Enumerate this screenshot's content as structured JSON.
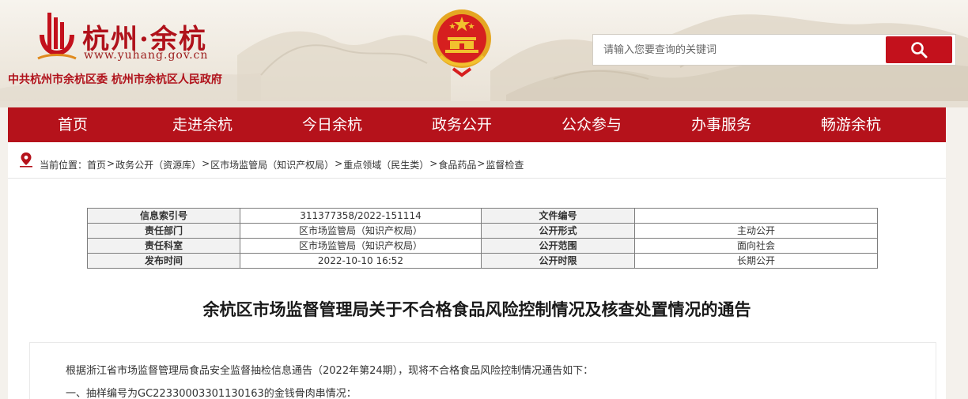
{
  "header": {
    "logo_title": "杭州·余杭",
    "logo_url": "www.yuhang.gov.cn",
    "site_owner": "中共杭州市余杭区委  杭州市余杭区人民政府",
    "search": {
      "placeholder": "请输入您要查询的关键词"
    }
  },
  "nav": {
    "items": [
      {
        "label": "首页"
      },
      {
        "label": "走进余杭"
      },
      {
        "label": "今日余杭"
      },
      {
        "label": "政务公开"
      },
      {
        "label": "公众参与"
      },
      {
        "label": "办事服务"
      },
      {
        "label": "畅游余杭"
      }
    ]
  },
  "breadcrumb": {
    "label": "当前位置：",
    "items": [
      {
        "label": "首页"
      },
      {
        "label": "政务公开（资源库）"
      },
      {
        "label": "区市场监管局（知识产权局）"
      },
      {
        "label": "重点领域（民生类）"
      },
      {
        "label": "食品药品"
      },
      {
        "label": "监督检查"
      }
    ],
    "separator": ">"
  },
  "meta": {
    "rows": [
      [
        "信息索引号",
        "311377358/2022-151114",
        "文件编号",
        ""
      ],
      [
        "责任部门",
        "区市场监管局（知识产权局）",
        "公开形式",
        "主动公开"
      ],
      [
        "责任科室",
        "区市场监管局（知识产权局）",
        "公开范围",
        "面向社会"
      ],
      [
        "发布时间",
        "2022-10-10 16:52",
        "公开时限",
        "长期公开"
      ]
    ]
  },
  "article": {
    "title": "余杭区市场监督管理局关于不合格食品风险控制情况及核查处置情况的通告",
    "paragraphs": [
      "根据浙江省市场监督管理局食品安全监督抽检信息通告（2022年第24期），现将不合格食品风险控制情况通告如下：",
      "一、抽样编号为GC22330003301130163的金钱骨肉串情况："
    ]
  },
  "colors": {
    "brand_red": "#b5121b",
    "search_red": "#c3111c"
  }
}
